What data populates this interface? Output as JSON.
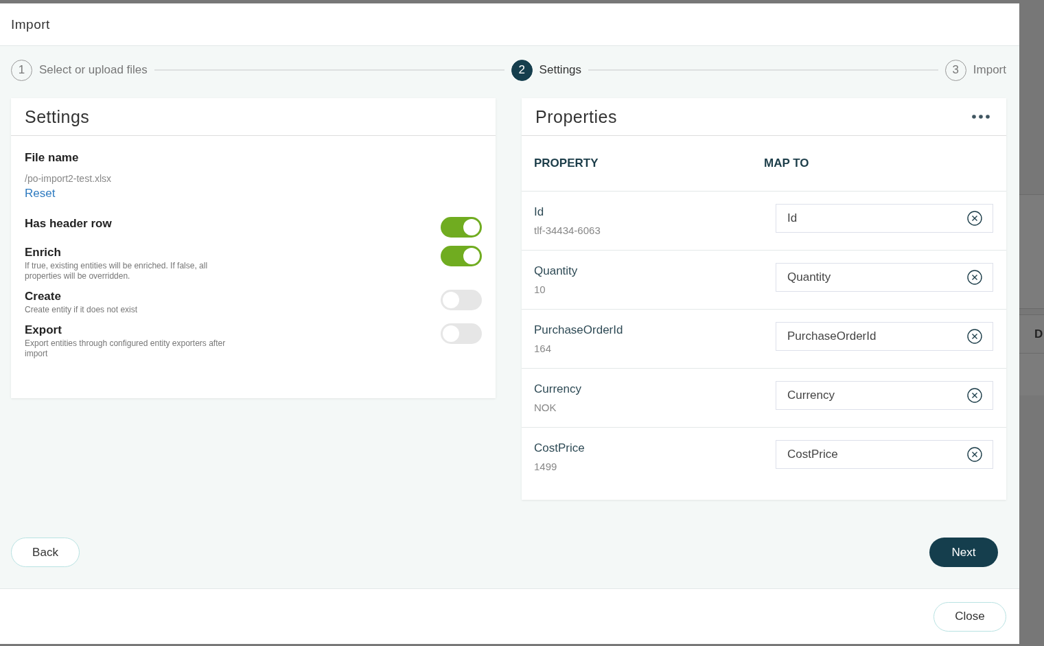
{
  "background": {
    "side_text": "D"
  },
  "window": {
    "title": "Import"
  },
  "steps": [
    {
      "number": "1",
      "label": "Select or upload files",
      "selected": false
    },
    {
      "number": "2",
      "label": "Settings",
      "selected": true
    },
    {
      "number": "3",
      "label": "Import",
      "selected": false
    }
  ],
  "settings": {
    "title": "Settings",
    "file_label": "File name",
    "file_name": "/po-import2-test.xlsx",
    "reset": "Reset",
    "options": [
      {
        "label": "Has header row",
        "on": true
      },
      {
        "label": "Enrich",
        "description": "If true, existing entities will be enriched. If false, all properties will be overridden.",
        "on": true
      },
      {
        "label": "Create",
        "description": "Create entity if it does not exist",
        "on": false
      },
      {
        "label": "Export",
        "description": "Export entities through configured entity exporters after import",
        "on": false
      }
    ]
  },
  "properties": {
    "title": "Properties",
    "columns": [
      "PROPERTY",
      "MAP TO"
    ],
    "rows": [
      {
        "name": "Id",
        "sample": "tlf-34434-6063",
        "map_to": "Id"
      },
      {
        "name": "Quantity",
        "sample": "10",
        "map_to": "Quantity"
      },
      {
        "name": "PurchaseOrderId",
        "sample": "164",
        "map_to": "PurchaseOrderId"
      },
      {
        "name": "Currency",
        "sample": "NOK",
        "map_to": "Currency"
      },
      {
        "name": "CostPrice",
        "sample": "1499",
        "map_to": "CostPrice"
      }
    ]
  },
  "buttons": {
    "back": "Back",
    "next": "Next",
    "close": "Close"
  }
}
